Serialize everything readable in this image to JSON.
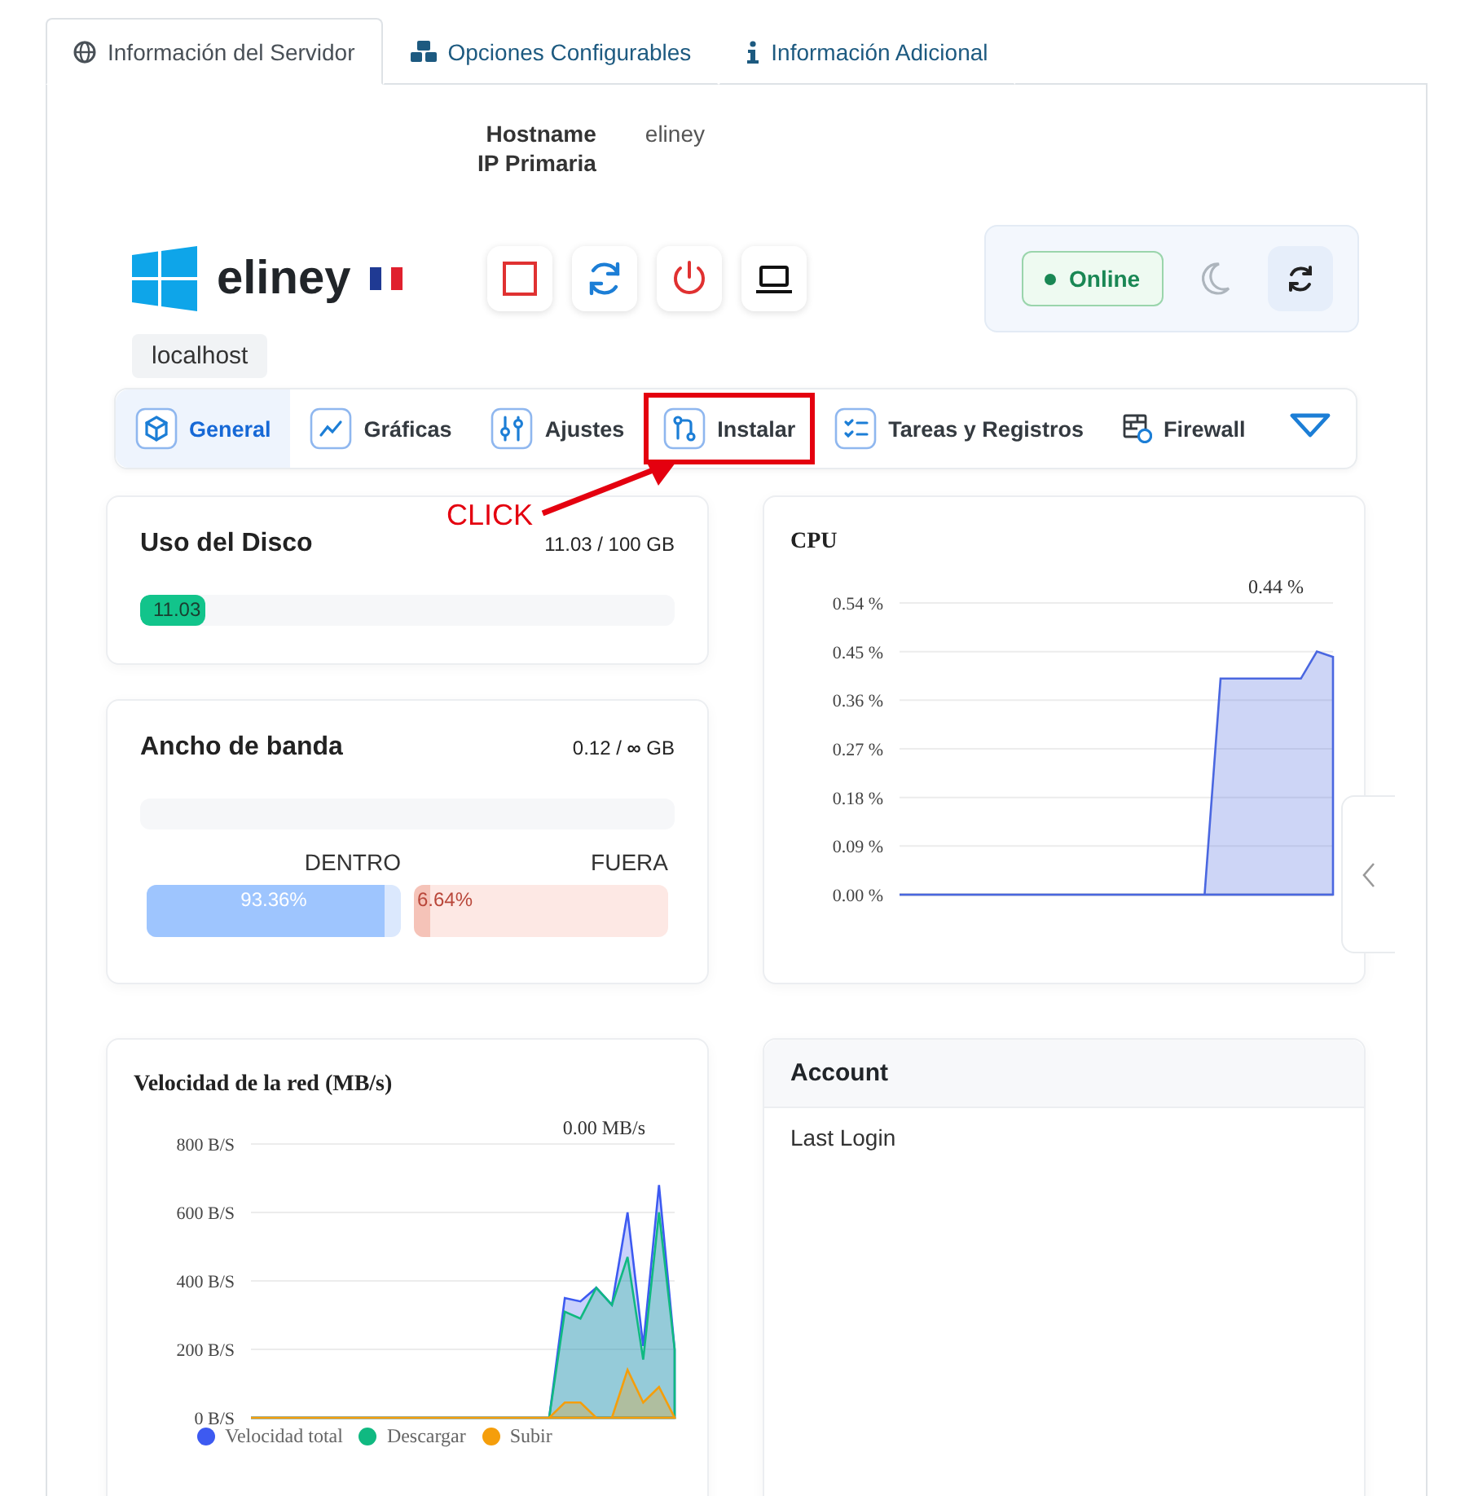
{
  "tabs": [
    {
      "label": "Información del Servidor",
      "selected": true
    },
    {
      "label": "Opciones Configurables",
      "selected": false
    },
    {
      "label": "Información Adicional",
      "selected": false
    }
  ],
  "server_info": [
    {
      "label": "Hostname",
      "value": "eliney"
    },
    {
      "label": "IP Primaria"
    }
  ],
  "server": {
    "name": "eliney",
    "hostname": "localhost",
    "status": "Online",
    "online": true
  },
  "actions": [
    {
      "kind": "stop"
    },
    {
      "kind": "restart"
    },
    {
      "kind": "power"
    },
    {
      "kind": "console"
    }
  ],
  "nav": [
    {
      "label": "General",
      "selected": true,
      "highlighted": false
    },
    {
      "label": "Gráficas",
      "selected": false,
      "highlighted": false
    },
    {
      "label": "Ajustes",
      "selected": false,
      "highlighted": false
    },
    {
      "label": "Instalar",
      "selected": false,
      "highlighted": true
    },
    {
      "label": "Tareas y Registros",
      "selected": false,
      "highlighted": false
    },
    {
      "label": "Firewall",
      "selected": false,
      "highlighted": false
    }
  ],
  "callout": {
    "text": "CLICK"
  },
  "disk": {
    "title": "Uso del Disco",
    "reading": "11.03 / 100 GB",
    "level": 0.1103,
    "fill_label": "11.03"
  },
  "bandwidth": {
    "title": "Ancho de banda",
    "reading": "0.12 / **∞** GB",
    "level": 0,
    "in": {
      "label": "DENTRO",
      "level": 0.9336,
      "reading": "93.36%"
    },
    "out": {
      "label": "FUERA",
      "level": 0.0664,
      "reading": "6.64%"
    }
  },
  "cpu": {
    "chart_data": {
      "type": "area",
      "title": "CPU",
      "grid": true,
      "ylim": [
        0,
        0.54
      ],
      "yticks": [
        {
          "value": 0,
          "label": "0.00 %"
        },
        {
          "value": 0.09,
          "label": "0.09 %"
        },
        {
          "value": 0.18,
          "label": "0.18 %"
        },
        {
          "value": 0.27,
          "label": "0.27 %"
        },
        {
          "value": 0.36,
          "label": "0.36 %"
        },
        {
          "value": 0.45,
          "label": "0.45 %"
        },
        {
          "value": 0.54,
          "label": "0.54 %"
        }
      ],
      "series": [
        {
          "color": "#4a67e0",
          "values": [
            0,
            0,
            0,
            0,
            0,
            0,
            0,
            0,
            0,
            0,
            0,
            0,
            0,
            0,
            0,
            0,
            0,
            0,
            0,
            0,
            0.4,
            0.4,
            0.4,
            0.4,
            0.4,
            0.4,
            0.45,
            0.44
          ]
        }
      ],
      "annotations": [
        {
          "text": "0.44 %"
        }
      ]
    }
  },
  "network": {
    "chart_data": {
      "type": "area",
      "title": "Velocidad de la red (MB/s)",
      "grid": true,
      "stacked": false,
      "ylim": [
        0,
        800
      ],
      "yticks": [
        {
          "value": 0,
          "label": "0 B/S"
        },
        {
          "value": 200,
          "label": "200 B/S"
        },
        {
          "value": 400,
          "label": "400 B/S"
        },
        {
          "value": 600,
          "label": "600 B/S"
        },
        {
          "value": 800,
          "label": "800 B/S"
        }
      ],
      "series": [
        {
          "name": "Velocidad total",
          "color": "#3d5af1",
          "values": [
            0,
            0,
            0,
            0,
            0,
            0,
            0,
            0,
            0,
            0,
            0,
            0,
            0,
            0,
            0,
            0,
            0,
            0,
            0,
            0,
            350,
            340,
            380,
            330,
            600,
            210,
            680,
            200
          ]
        },
        {
          "name": "Descargar",
          "color": "#10b981",
          "values": [
            0,
            0,
            0,
            0,
            0,
            0,
            0,
            0,
            0,
            0,
            0,
            0,
            0,
            0,
            0,
            0,
            0,
            0,
            0,
            0,
            310,
            290,
            380,
            330,
            470,
            170,
            600,
            200
          ]
        },
        {
          "name": "Subir",
          "color": "#f59e0b",
          "values": [
            0,
            0,
            0,
            0,
            0,
            0,
            0,
            0,
            0,
            0,
            0,
            0,
            0,
            0,
            0,
            0,
            0,
            0,
            0,
            0,
            45,
            45,
            0,
            0,
            140,
            45,
            90,
            0
          ]
        }
      ],
      "annotations": [
        {
          "text": "0.00 MB/s"
        }
      ]
    }
  },
  "account": {
    "title": "Account",
    "rows": [
      "Last Login"
    ]
  }
}
